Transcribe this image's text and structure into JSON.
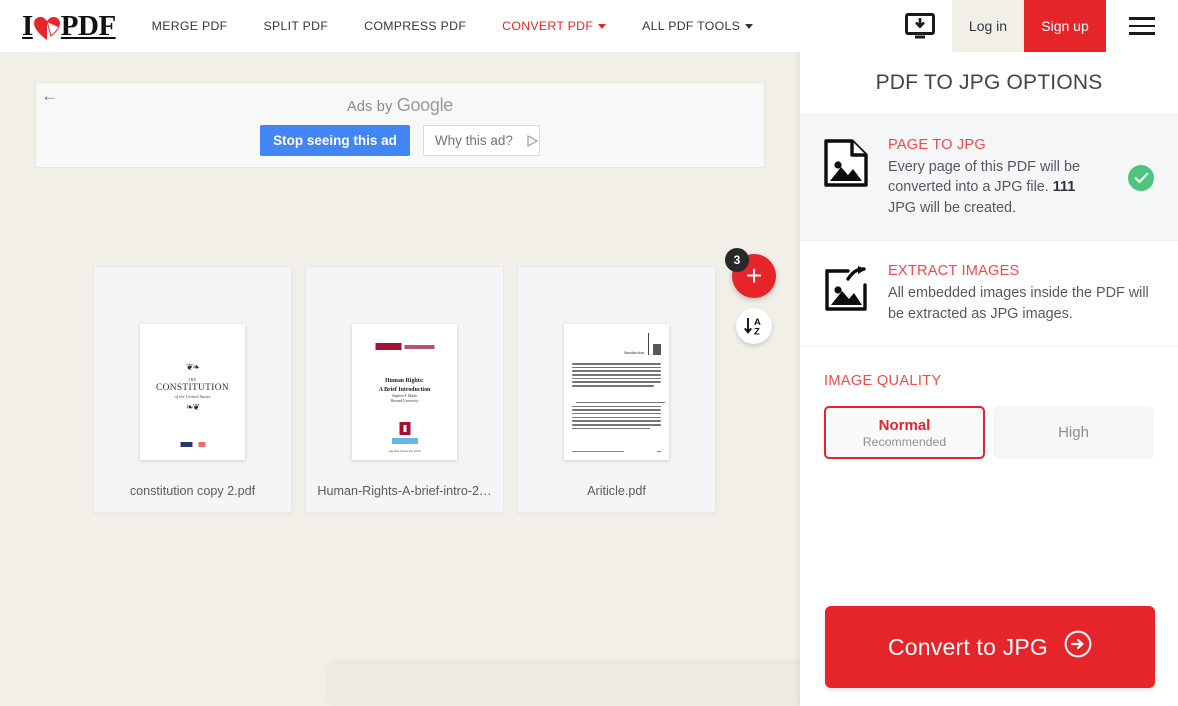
{
  "header": {
    "logo_i": "I",
    "logo_pdf": "PDF",
    "nav": [
      {
        "label": "MERGE PDF",
        "active": false
      },
      {
        "label": "SPLIT PDF",
        "active": false
      },
      {
        "label": "COMPRESS PDF",
        "active": false
      },
      {
        "label": "CONVERT PDF",
        "active": true,
        "caret": true
      },
      {
        "label": "ALL PDF TOOLS",
        "active": false,
        "caret": true
      }
    ],
    "login_label": "Log in",
    "signup_label": "Sign up",
    "desktop_icon": "desktop-download-icon",
    "menu_icon": "hamburger-menu-icon"
  },
  "ad": {
    "back_icon": "←",
    "ads_by_prefix": "Ads by ",
    "ads_by_brand": "Google",
    "stop_label": "Stop seeing this ad",
    "why_label": "Why this ad?"
  },
  "files": {
    "add_button_label": "+",
    "add_badge_count": "3",
    "sort_icon": "sort-az-icon",
    "items": [
      {
        "name": "constitution copy 2.pdf",
        "thumb_kind": "constitution",
        "thumb_the": "THE",
        "thumb_title": "CONSTITUTION",
        "thumb_subtitle": "of the United States"
      },
      {
        "name": "Human-Rights-A-brief-intro-2…",
        "thumb_kind": "humanrights",
        "thumb_title": "Human Rights:\nA Brief Introduction",
        "thumb_author": "Stephen P. Marks\nHarvard University",
        "thumb_footer": "Harvard University 2016"
      },
      {
        "name": "Ariticle.pdf",
        "thumb_kind": "article",
        "thumb_header": "Introduction"
      }
    ]
  },
  "sidebar": {
    "title": "PDF TO JPG OPTIONS",
    "options": [
      {
        "title": "PAGE TO JPG",
        "desc_before": "Every page of this PDF will be converted into a JPG file. ",
        "desc_bold": "111",
        "desc_after": " JPG will be created.",
        "icon": "image-file-icon",
        "selected": true,
        "check_icon": "check-circle-icon"
      },
      {
        "title": "EXTRACT IMAGES",
        "desc_before": "All embedded images inside the PDF will be extracted as JPG images.",
        "desc_bold": "",
        "desc_after": "",
        "icon": "image-export-icon",
        "selected": false
      }
    ],
    "quality": {
      "label": "IMAGE QUALITY",
      "options": [
        {
          "main": "Normal",
          "sub": "Recommended",
          "active": true
        },
        {
          "main": "High",
          "sub": "",
          "active": false
        }
      ]
    },
    "convert_label": "Convert to JPG",
    "convert_icon": "arrow-circle-right-icon"
  },
  "colors": {
    "brand_red": "#E5252A",
    "option_red": "#EE4B4B",
    "check_green": "#4CC57F",
    "ad_blue": "#4285F4",
    "workspace_bg": "#F2EFE9"
  }
}
